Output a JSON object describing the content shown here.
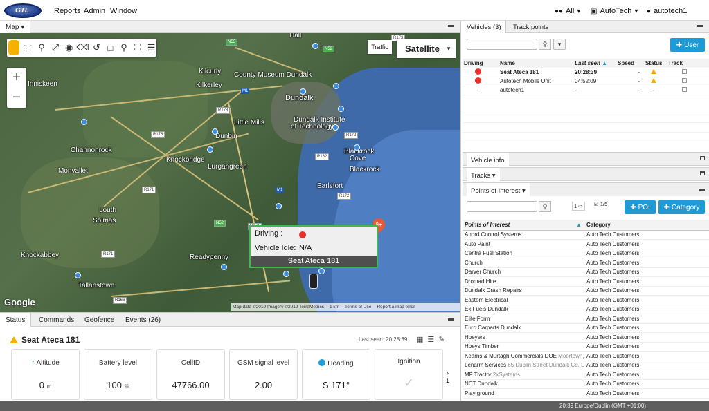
{
  "topbar": {
    "logo_text": "GTL",
    "menu": [
      "Reports",
      "Admin",
      "Window"
    ],
    "right": {
      "all_label": "All",
      "company": "AutoTech",
      "user": "autotech1"
    }
  },
  "map_panel": {
    "tab_label": "Map",
    "traffic_label": "Traffic",
    "maptype_label": "Satellite",
    "zoom_in": "+",
    "zoom_out": "−",
    "google_label": "Google",
    "attribution": [
      "Map data ©2019 Imagery ©2019 TerraMetrics",
      "1 km",
      "Terms of Use",
      "Report a map error"
    ],
    "cluster_badge": "9+",
    "labels": [
      "Hall",
      "Kilcurly",
      "County Museum Dundalk",
      "Kilkerley",
      "Dundalk",
      "Dundalk Institute",
      "of Technology",
      "Little Mills",
      "Dunbin",
      "Inniskeen",
      "Channonrock",
      "Monvallet",
      "Knockbridge",
      "Lurgangreen",
      "Blackrock",
      "Cove",
      "Blackrock",
      "Earlsfort",
      "Louth",
      "Solmas",
      "Knockabbey",
      "Readypenny",
      "Tallanstown"
    ],
    "roads": [
      "R173",
      "N52",
      "R178",
      "M1",
      "R178",
      "R171",
      "R172",
      "R132",
      "M1",
      "R172",
      "R171",
      "R171",
      "N52",
      "R166",
      "N53"
    ],
    "popup": {
      "driving_label": "Driving :",
      "idle_label": "Vehicle Idle:",
      "idle_value": "N/A",
      "vehicle_name": "Seat Ateca 181",
      "driving_status_color": "#e8312b"
    }
  },
  "status_panel": {
    "tabs": [
      "Status",
      "Commands",
      "Geofence",
      "Events (26)"
    ],
    "vehicle_name": "Seat Ateca 181",
    "last_seen": "Last seen: 20:28:39",
    "cards": [
      {
        "label": "Altitude",
        "value": "0",
        "unit": "m",
        "icon": "arrow-up-icon"
      },
      {
        "label": "Battery level",
        "value": "100",
        "unit": "%"
      },
      {
        "label": "CellID",
        "value": "47766.00",
        "unit": ""
      },
      {
        "label": "GSM signal level",
        "value": "2.00",
        "unit": ""
      },
      {
        "label": "Heading",
        "value": "S 171°",
        "unit": "",
        "icon": "compass-icon"
      },
      {
        "label": "Ignition",
        "value": "✓",
        "unit": ""
      }
    ],
    "pager": "1"
  },
  "vehicles_panel": {
    "tabs": [
      "Vehicles (3)",
      "Track points"
    ],
    "add_user_label": "User",
    "columns": [
      "Driving",
      "Name",
      "Last seen",
      "Speed",
      "Status",
      "Track"
    ],
    "rows": [
      {
        "driving": "red",
        "name": "Seat Ateca 181",
        "last_seen": "20:28:39",
        "speed": "-",
        "status": "warn",
        "bold": true
      },
      {
        "driving": "red",
        "name": "Autotech Mobile Unit",
        "last_seen": "04:52:09",
        "speed": "-",
        "status": "warn",
        "bold": false
      },
      {
        "driving": "-",
        "name": "autotech1",
        "last_seen": "-",
        "speed": "-",
        "status": "-",
        "bold": false
      }
    ]
  },
  "sections": {
    "vehicle_info": "Vehicle info",
    "tracks": "Tracks",
    "poi": "Points of Interest"
  },
  "poi_panel": {
    "pager_page": "1",
    "pager_count": "1/5",
    "poi_btn": "POI",
    "category_btn": "Category",
    "columns": [
      "Points of Interest",
      "Category"
    ],
    "rows": [
      {
        "name": "Anord Control Systems",
        "extra": "",
        "cat": "Auto Tech Customers"
      },
      {
        "name": "Auto Paint",
        "extra": "",
        "cat": "Auto Tech Customers"
      },
      {
        "name": "Centra Fuel Station",
        "extra": "",
        "cat": "Auto Tech Customers"
      },
      {
        "name": "Church",
        "extra": "",
        "cat": "Auto Tech Customers"
      },
      {
        "name": "Darver Church",
        "extra": "",
        "cat": "Auto Tech Customers"
      },
      {
        "name": "Dromad Hire",
        "extra": "",
        "cat": "Auto Tech Customers"
      },
      {
        "name": "Dundalk Crash Repairs",
        "extra": "",
        "cat": "Auto Tech Customers"
      },
      {
        "name": "Eastern Electrical",
        "extra": "",
        "cat": "Auto Tech Customers"
      },
      {
        "name": "Ek Fuels Dundalk",
        "extra": "",
        "cat": "Auto Tech Customers"
      },
      {
        "name": "Elite Form",
        "extra": "",
        "cat": "Auto Tech Customers"
      },
      {
        "name": "Euro Carparts Dundalk",
        "extra": "",
        "cat": "Auto Tech Customers"
      },
      {
        "name": "Hoeyers",
        "extra": "",
        "cat": "Auto Tech Customers"
      },
      {
        "name": "Hoeys Timber",
        "extra": "",
        "cat": "Auto Tech Customers"
      },
      {
        "name": "Kearns & Murtagh Commercials DOE",
        "extra": "Moortown,",
        "cat": "Auto Tech Customers"
      },
      {
        "name": "Lenarm Services",
        "extra": "65 Dublin Street Dundalk Co. L",
        "cat": "Auto Tech Customers"
      },
      {
        "name": "MF Tractor",
        "extra": "2xSystems",
        "cat": "Auto Tech Customers"
      },
      {
        "name": "NCT Dundalk",
        "extra": "",
        "cat": "Auto Tech Customers"
      },
      {
        "name": "Play ground",
        "extra": "",
        "cat": "Auto Tech Customers"
      }
    ]
  },
  "footer": {
    "time": "20:39 Europe/Dublin (GMT +01:00)"
  }
}
